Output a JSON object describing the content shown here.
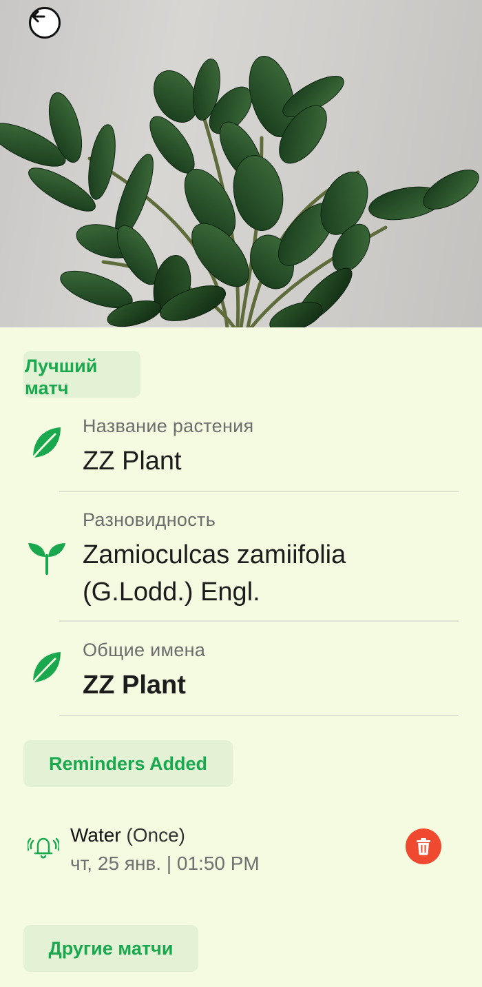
{
  "header": {
    "back_icon": "arrow-left-icon"
  },
  "best_match": {
    "badge_label": "Лучший матч",
    "rows": [
      {
        "label": "Название растения",
        "value": "ZZ Plant",
        "icon": "leaf-icon"
      },
      {
        "label": "Разновидность",
        "value_line1": "Zamioculcas zamiifolia",
        "value_line2": "(G.Lodd.) Engl.",
        "icon": "sprout-icon"
      },
      {
        "label": "Общие имена",
        "value": "ZZ Plant",
        "icon": "leaf-icon"
      }
    ]
  },
  "reminders": {
    "badge_label": "Reminders Added",
    "items": [
      {
        "title": "Water",
        "frequency": "(Once)",
        "datetime": "чт, 25 янв. | 01:50 PM",
        "icon": "alarm-bell-icon"
      }
    ]
  },
  "other_matches": {
    "badge_label": "Другие матчи"
  },
  "colors": {
    "background": "#f4fbe1",
    "accent_green": "#1aa84f",
    "badge_bg": "#e3f2d4",
    "delete_red": "#ef4a2f"
  }
}
